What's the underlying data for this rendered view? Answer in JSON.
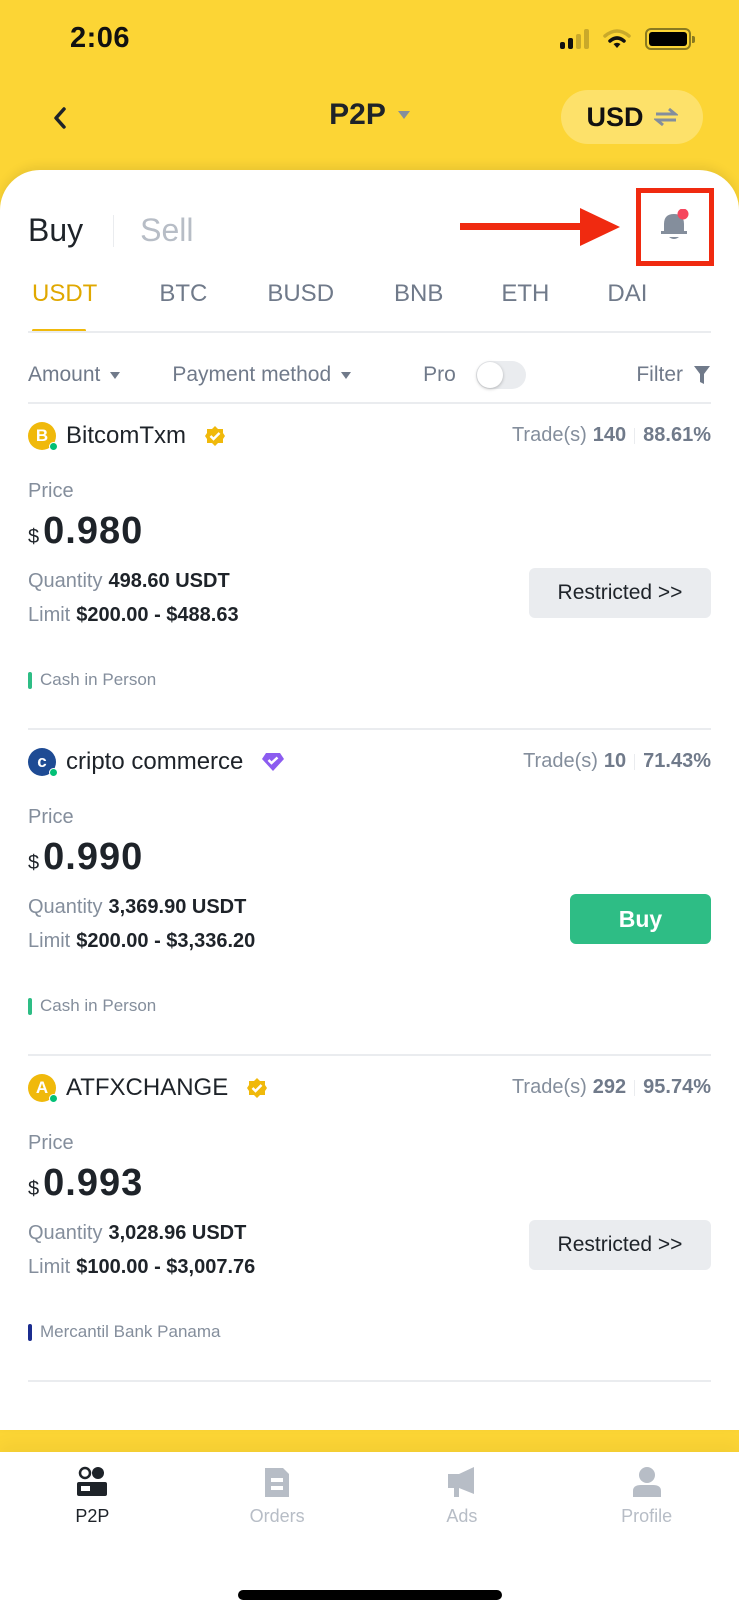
{
  "status_bar": {
    "time": "2:06"
  },
  "nav": {
    "title": "P2P",
    "currency": "USD"
  },
  "side_tabs": [
    {
      "label": "Buy",
      "active": true
    },
    {
      "label": "Sell",
      "active": false
    }
  ],
  "coin_tabs": [
    {
      "label": "USDT",
      "active": true
    },
    {
      "label": "BTC",
      "active": false
    },
    {
      "label": "BUSD",
      "active": false
    },
    {
      "label": "BNB",
      "active": false
    },
    {
      "label": "ETH",
      "active": false
    },
    {
      "label": "DAI",
      "active": false
    }
  ],
  "filters": {
    "amount": "Amount",
    "payment_method": "Payment method",
    "pro": "Pro",
    "pro_enabled": false,
    "filter": "Filter"
  },
  "annotation": {
    "color": "#F02A10",
    "target": "notification-bell"
  },
  "listings": [
    {
      "avatar_letter": "B",
      "avatar_color": "#F0B90B",
      "advertiser": "BitcomTxm",
      "badge_color": "#F0B90B",
      "trades_label": "Trade(s)",
      "trades": "140",
      "completion": "88.61%",
      "price_label": "Price",
      "currency_symbol": "$",
      "price": "0.980",
      "quantity_label": "Quantity",
      "quantity": "498.60 USDT",
      "limit_label": "Limit",
      "limit": "$200.00 - $488.63",
      "action": "Restricted >>",
      "action_type": "restricted",
      "payment_method": "Cash in Person",
      "payment_color": "#2EBD85"
    },
    {
      "avatar_letter": "c",
      "avatar_color": "#1E4B94",
      "advertiser": "cripto commerce",
      "badge_color": "#8C5CF0",
      "trades_label": "Trade(s)",
      "trades": "10",
      "completion": "71.43%",
      "price_label": "Price",
      "currency_symbol": "$",
      "price": "0.990",
      "quantity_label": "Quantity",
      "quantity": "3,369.90 USDT",
      "limit_label": "Limit",
      "limit": "$200.00 - $3,336.20",
      "action": "Buy",
      "action_type": "buy",
      "payment_method": "Cash in Person",
      "payment_color": "#2EBD85"
    },
    {
      "avatar_letter": "A",
      "avatar_color": "#F0B90B",
      "advertiser": "ATFXCHANGE",
      "badge_color": "#F0B90B",
      "trades_label": "Trade(s)",
      "trades": "292",
      "completion": "95.74%",
      "price_label": "Price",
      "currency_symbol": "$",
      "price": "0.993",
      "quantity_label": "Quantity",
      "quantity": "3,028.96 USDT",
      "limit_label": "Limit",
      "limit": "$100.00 - $3,007.76",
      "action": "Restricted >>",
      "action_type": "restricted",
      "payment_method": "Mercantil Bank Panama",
      "payment_color": "#1B2D8F"
    }
  ],
  "bottom_nav": [
    {
      "label": "P2P",
      "icon": "p2p-users-icon",
      "active": true
    },
    {
      "label": "Orders",
      "icon": "orders-document-icon",
      "active": false
    },
    {
      "label": "Ads",
      "icon": "ads-megaphone-icon",
      "active": false
    },
    {
      "label": "Profile",
      "icon": "profile-person-icon",
      "active": false
    }
  ]
}
